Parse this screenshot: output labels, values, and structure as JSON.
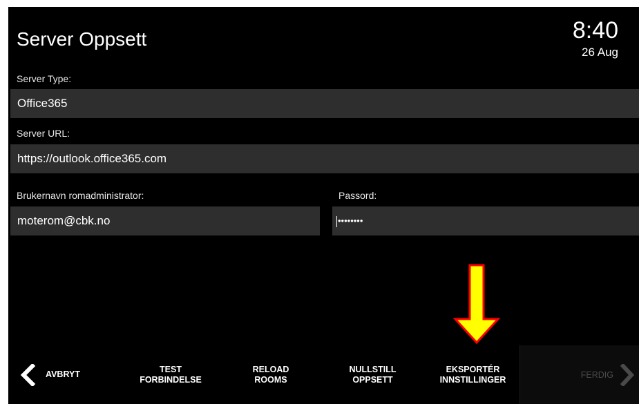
{
  "header": {
    "title": "Server Oppsett",
    "time": "8:40",
    "date": "26 Aug"
  },
  "form": {
    "server_type": {
      "label": "Server Type:",
      "value": "Office365"
    },
    "server_url": {
      "label": "Server URL:",
      "value": "https://outlook.office365.com"
    },
    "username": {
      "label": "Brukernavn romadministrator:",
      "value": "moterom@cbk.no"
    },
    "password": {
      "label": "Passord:",
      "value": "••••••••"
    }
  },
  "buttons": {
    "cancel": "AVBRYT",
    "test": "TEST\nFORBINDELSE",
    "reload": "RELOAD\nROOMS",
    "reset": "NULLSTILL\nOPPSETT",
    "export": "EKSPORTÉR\nINNSTILLINGER",
    "done": "FERDIG"
  },
  "annotation": {
    "arrow_color": "#ffff00",
    "arrow_outline": "#ff0000"
  },
  "icons": {
    "back": "chevron-left-icon",
    "forward": "chevron-right-icon"
  }
}
